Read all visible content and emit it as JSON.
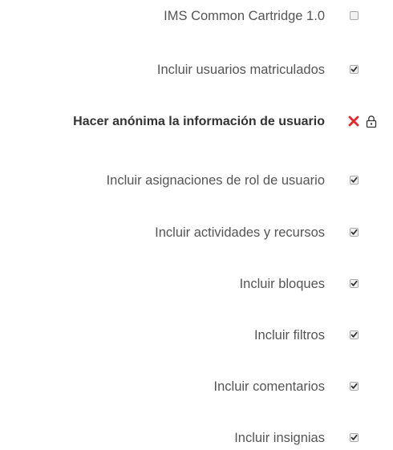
{
  "settings": [
    {
      "label": "IMS Common Cartridge 1.0",
      "checked": false,
      "locked": false
    },
    {
      "label": "Incluir usuarios matriculados",
      "checked": true,
      "locked": false
    },
    {
      "label": "Hacer anónima la información de usuario",
      "checked": false,
      "locked": true,
      "emphasis": true
    },
    {
      "label": "Incluir asignaciones de rol de usuario",
      "checked": true,
      "locked": false
    },
    {
      "label": "Incluir actividades y recursos",
      "checked": true,
      "locked": false
    },
    {
      "label": "Incluir bloques",
      "checked": true,
      "locked": false
    },
    {
      "label": "Incluir filtros",
      "checked": true,
      "locked": false
    },
    {
      "label": "Incluir comentarios",
      "checked": true,
      "locked": false
    },
    {
      "label": "Incluir insignias",
      "checked": true,
      "locked": false
    }
  ],
  "colors": {
    "text": "#555555",
    "emphasis_text": "#333333",
    "cross": "#e8262b",
    "checkbox_border": "#a9a9a9",
    "checkmark": "#333333"
  },
  "icons": {
    "locked_state": "cross-icon",
    "lock": "lock-icon"
  }
}
